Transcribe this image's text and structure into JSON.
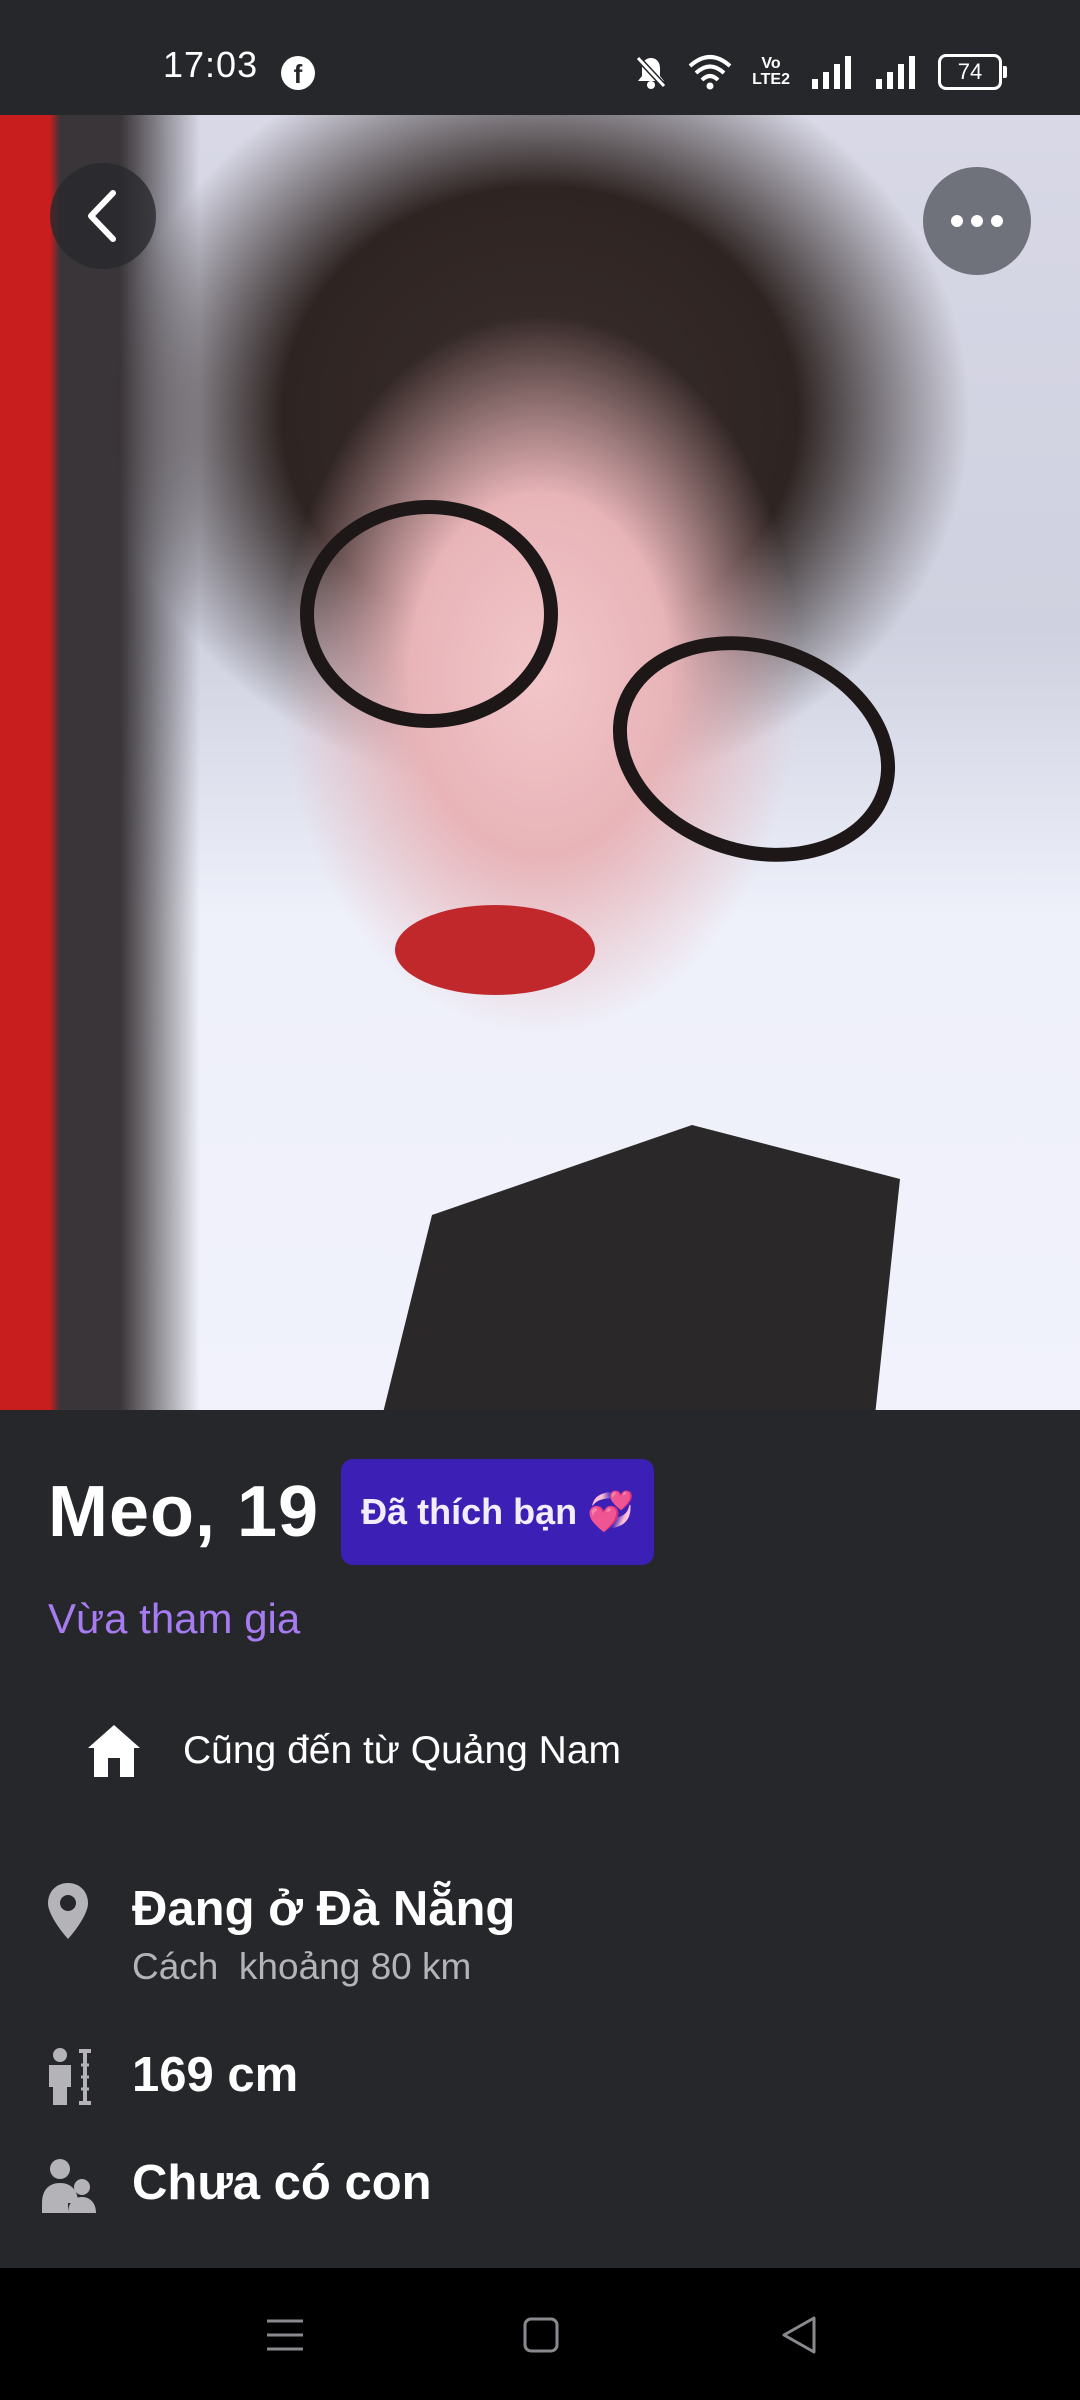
{
  "status_bar": {
    "time": "17:03",
    "app_icon": "facebook-icon",
    "icons": [
      "mute-icon",
      "wifi-icon",
      "volte-icon",
      "signal-icon",
      "signal-icon"
    ],
    "volte_label_top": "Vo",
    "volte_label_bottom": "LTE2",
    "battery": "74"
  },
  "photo": {
    "description_icon": "profile-photo",
    "back_icon": "chevron-left-icon",
    "more_icon": "more-horizontal-icon"
  },
  "profile": {
    "name_age": "Meo, 19",
    "liked_badge": "Đã thích bạn",
    "liked_badge_emoji": "💞",
    "joined_status": "Vừa tham gia",
    "hometown": "Cũng đến từ Quảng Nam",
    "location_main": "Đang ở Đà Nẵng",
    "location_sub": "Cách  khoảng 80 km",
    "height": "169 cm",
    "children": "Chưa có con"
  },
  "colors": {
    "background": "#26272b",
    "badge": "#3c1fb5",
    "accent_purple": "#a77bf2"
  },
  "nav_bar": {
    "icons": [
      "menu-icon",
      "home-square-icon",
      "back-triangle-icon"
    ]
  }
}
